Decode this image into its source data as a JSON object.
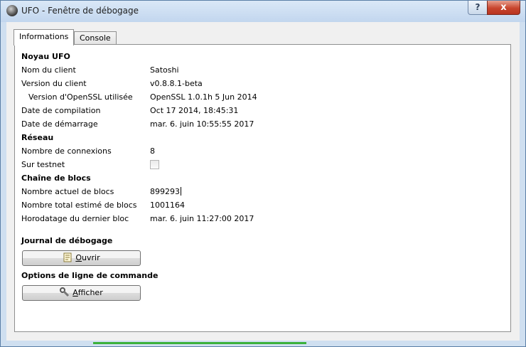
{
  "window": {
    "title": "UFO - Fenêtre de débogage",
    "help_label": "?",
    "close_label": "x"
  },
  "tabs": [
    {
      "label": "Informations",
      "active": true
    },
    {
      "label": "Console",
      "active": false
    }
  ],
  "info": {
    "core_section": "Noyau UFO",
    "client_name_label": "Nom du client",
    "client_name_value": "Satoshi",
    "client_version_label": "Version du client",
    "client_version_value": "v0.8.8.1-beta",
    "openssl_label": "Version d'OpenSSL utilisée",
    "openssl_value": "OpenSSL 1.0.1h 5 Jun 2014",
    "build_date_label": "Date de compilation",
    "build_date_value": "Oct 17 2014, 18:45:31",
    "startup_label": "Date de démarrage",
    "startup_value": "mar. 6. juin 10:55:55 2017",
    "network_section": "Réseau",
    "connections_label": "Nombre de connexions",
    "connections_value": "8",
    "testnet_label": "Sur testnet",
    "testnet_checked": false,
    "blockchain_section": "Chaîne de blocs",
    "current_blocks_label": "Nombre actuel de blocs",
    "current_blocks_value": "899293",
    "estimated_blocks_label": "Nombre total estimé de blocs",
    "estimated_blocks_value": "1001164",
    "last_block_label": "Horodatage du dernier bloc",
    "last_block_value": "mar. 6. juin 11:27:00 2017",
    "debug_log_section": "Journal de débogage",
    "open_first": "O",
    "open_rest": "uvrir",
    "cmdline_section": "Options de ligne de commande",
    "show_first": "A",
    "show_rest": "fficher"
  },
  "colors": {
    "status_bar": "#3bb13b",
    "close_button": "#c8452e"
  }
}
